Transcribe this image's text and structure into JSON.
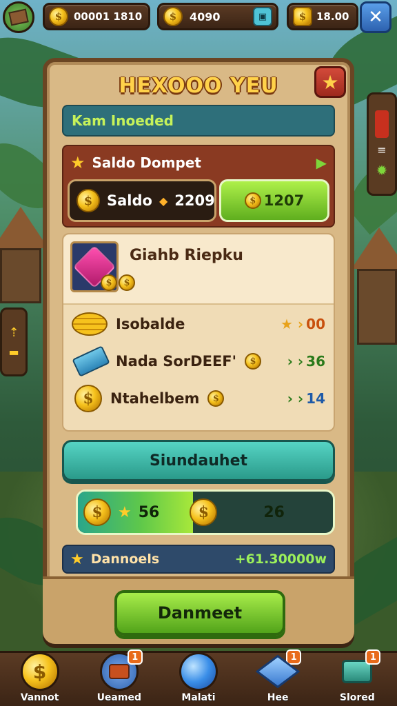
{
  "topbar": {
    "coins_value": "00001 1810",
    "gems_value": "4090",
    "gold_value": "18.00",
    "home_icon": "crate-icon",
    "robot_icon": "robot-icon",
    "close_icon": "close-icon"
  },
  "panel": {
    "title": "HEXOOO YEU",
    "subheading": "Kam Inoeded",
    "balance": {
      "header": "Saldo Dompet",
      "saldo_label": "Saldo",
      "saldo_value": "2209",
      "green_value": "1207"
    },
    "offer": {
      "title": "Giahb Riepku",
      "rows": [
        {
          "label": "Isobalde",
          "value": "00",
          "prefix": "★ ›"
        },
        {
          "label": "Nada SorDEEF'",
          "value": "36",
          "prefix": "› ›"
        },
        {
          "label": "Ntahelbem",
          "value": "14",
          "prefix": "› ›"
        }
      ]
    },
    "teal_button": "Siundauhet",
    "progress": {
      "left_value": "56",
      "right_value": "26",
      "fill_fraction": 0.45
    },
    "info": {
      "label": "Dannoels",
      "value": "+61.30000w"
    },
    "main_button": "Danmeet"
  },
  "bottom_nav": [
    {
      "label": "Vannot",
      "icon": "coin-icon",
      "badge": ""
    },
    {
      "label": "Ueamed",
      "icon": "chest-icon",
      "badge": "1"
    },
    {
      "label": "Malati",
      "icon": "orb-icon",
      "badge": ""
    },
    {
      "label": "Hee",
      "icon": "box-icon",
      "badge": "1"
    },
    {
      "label": "Slored",
      "icon": "store-icon",
      "badge": "1"
    }
  ],
  "colors": {
    "accent_green": "#7ed63a",
    "panel_wood": "#d9b986",
    "title_gold": "#ffd24a"
  }
}
